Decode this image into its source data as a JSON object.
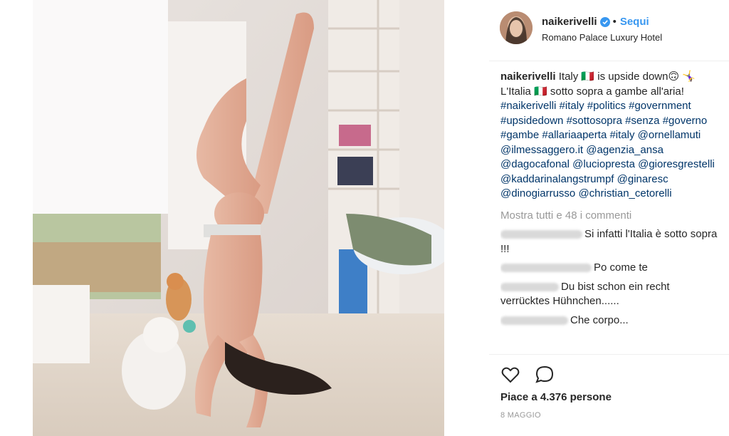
{
  "post": {
    "username": "naikerivelli",
    "follow_label": "Sequi",
    "separator": "•",
    "location": "Romano Palace Luxury Hotel",
    "caption": {
      "username": "naikerivelli",
      "text_line1": "Italy 🇮🇹 is upside down🙃 🤸‍♀️",
      "text_line2": "L'Italia 🇮🇹 sotto sopra a gambe all'aria!",
      "tags": [
        "#naikerivelli",
        "#italy",
        "#politics",
        "#government",
        "#upsidedown",
        "#sottosopra",
        "#senza",
        "#governo",
        "#gambe",
        "#allariaaperta",
        "#italy",
        "@ornellamuti",
        "@ilmessaggero.it",
        "@agenzia_ansa",
        "@dagocafonal",
        "@luciopresta",
        "@gioresgrestelli",
        "@kaddarinalangstrumpf",
        "@ginaresc",
        "@dinogiarrusso",
        "@christian_cetorelli"
      ]
    },
    "show_all_comments": "Mostra tutti e 48 i commenti",
    "comments": [
      {
        "text": "Si infatti l'Italia è sotto sopra !!!"
      },
      {
        "text": "Po come te"
      },
      {
        "text": "Du bist schon ein recht verrücktes Hühnchen......"
      },
      {
        "text": "Che corpo..."
      }
    ],
    "likes": "Piace a 4.376 persone",
    "date": "8 MAGGIO"
  },
  "icons": {
    "verified": "verified-badge-icon",
    "like": "heart-icon",
    "comment": "speech-bubble-icon"
  },
  "colors": {
    "link": "#3897f0",
    "tag": "#003569",
    "muted": "#999999"
  }
}
